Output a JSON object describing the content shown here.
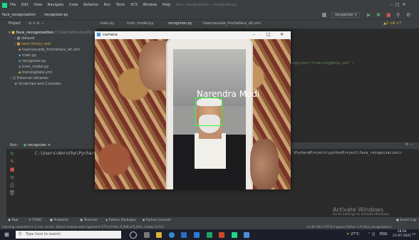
{
  "menu": [
    "File",
    "Edit",
    "View",
    "Navigate",
    "Code",
    "Refactor",
    "Run",
    "Tools",
    "VCS",
    "Window",
    "Help"
  ],
  "window_title": "face_recognization - recognizer.py",
  "breadcrumb": [
    "face_recognization",
    "recognizer.py"
  ],
  "run_config": "recognizer",
  "tabs": [
    "main.py",
    "train_model.py",
    "recognizer.py",
    "haarcascade_frontalface_alt.xml"
  ],
  "project": {
    "label": "Project",
    "root": "face_recognization",
    "root_path": "C:\\Users\\Amrutha\\PycharmP",
    "items": [
      "dataset",
      "venv  library root",
      "haarcascade_frontalface_alt.xml",
      "main.py",
      "recognizer.py",
      "train_model.py",
      "trainingData.yml"
    ],
    "extra": [
      "External Libraries",
      "Scratches and Consoles"
    ]
  },
  "editor_snippet": "ecognizer\\trainingData.yml')",
  "run": {
    "label": "Run:",
    "tab": "recognizer"
  },
  "console": {
    "line_left": "C:\\Users\\Amrutha\\Pycharm",
    "line_right": "\\PycharmProjects\\pythonProject\\face_recognization\\r"
  },
  "camera": {
    "title": "camera",
    "detected_name": "Narendra Modi"
  },
  "bottom_tabs": [
    "Run",
    "TODO",
    "Problems",
    "Terminal",
    "Python Packages",
    "Python Console"
  ],
  "event_log": "Event Log",
  "status": {
    "message": "Indexing completed in 2 min, 14 sec. Shared indexes were applied to 57% of files (2,998 of 6,563). (today 13:55)",
    "right": "13:48  CRLF  UTF-8  4 spaces  Python 3.9 (face_recognization)"
  },
  "watermark": {
    "title": "Activate Windows",
    "sub": "Go to Settings to activate Windows."
  },
  "taskbar": {
    "search": "Type here to search",
    "weather": "27°C",
    "lang": "ENG",
    "time": "18:04",
    "date": "21-07-2021"
  },
  "colors": {
    "accent_green": "#33ff33",
    "ide_bg": "#2b2b2b",
    "panel": "#3c3f41",
    "taskbar": "#1c1f2a"
  }
}
